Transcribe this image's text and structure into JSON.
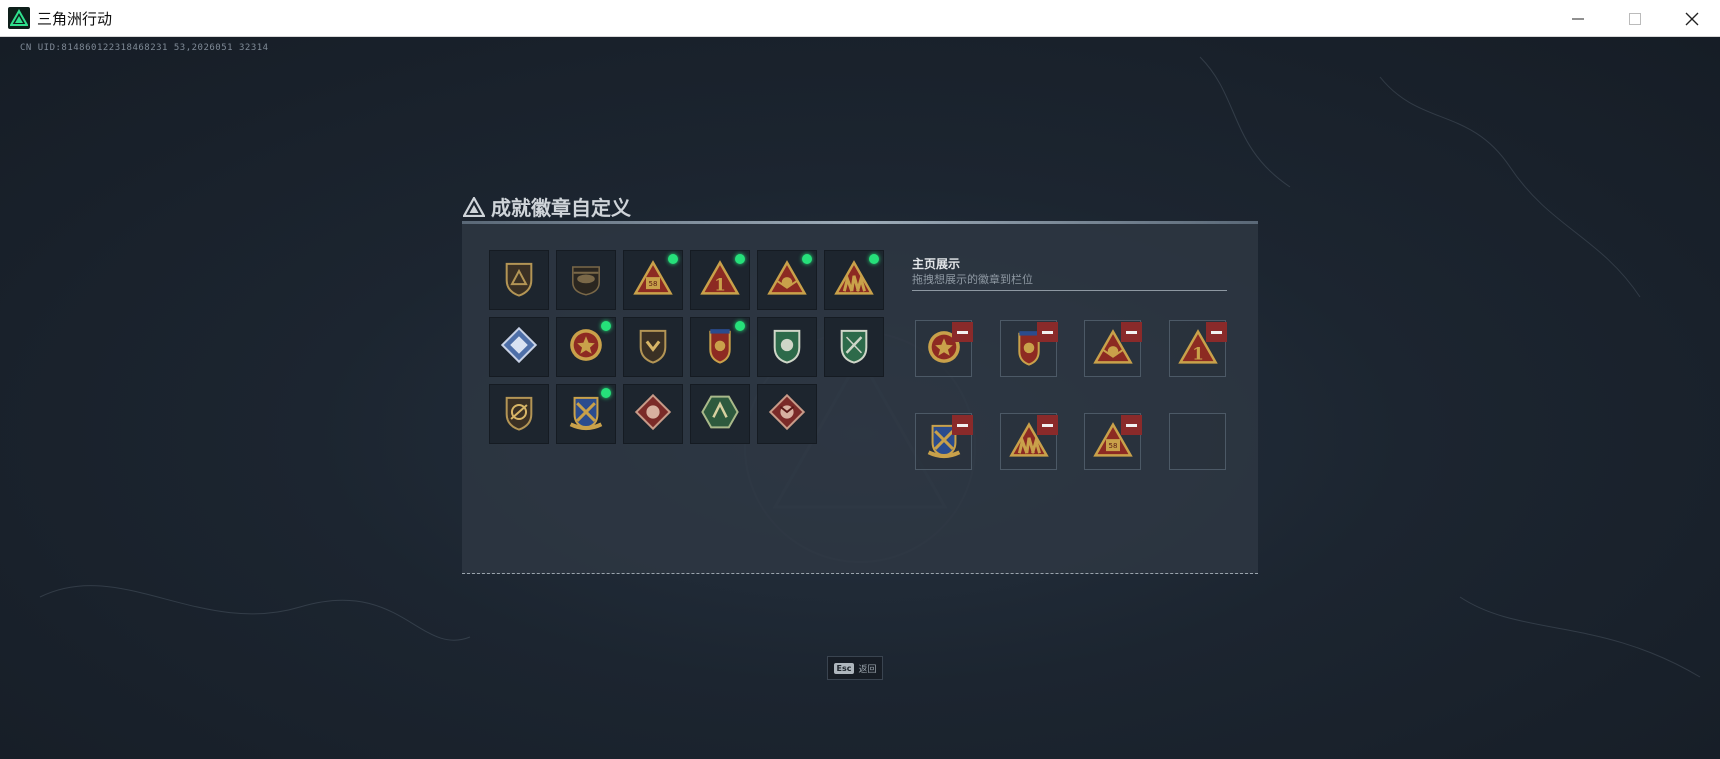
{
  "window": {
    "title": "三角洲行动",
    "controls": [
      "minimize",
      "maximize",
      "close"
    ]
  },
  "uid_text": "CN UID:814860122318468231 53,2026051 32314",
  "panel": {
    "title": "成就徽章自定义",
    "badges": [
      {
        "icon": "delta-shield-badge",
        "new": false
      },
      {
        "icon": "helicopter-badge",
        "new": false
      },
      {
        "icon": "triangle-58-badge",
        "new": true
      },
      {
        "icon": "triangle-1-badge",
        "new": true
      },
      {
        "icon": "triangle-winged-badge",
        "new": true
      },
      {
        "icon": "triangle-soldiers-badge",
        "new": true
      },
      {
        "icon": "blue-diamond-badge",
        "new": false
      },
      {
        "icon": "red-star-medal-badge",
        "new": true
      },
      {
        "icon": "shield-chevron-badge",
        "new": false
      },
      {
        "icon": "ribbon-shield-badge",
        "new": true
      },
      {
        "icon": "green-lion-shield-badge",
        "new": false
      },
      {
        "icon": "green-crossed-shield-badge",
        "new": false
      },
      {
        "icon": "slash-shield-badge",
        "new": false
      },
      {
        "icon": "crossed-swords-crest-badge",
        "new": true
      },
      {
        "icon": "beast-diamond-badge",
        "new": false
      },
      {
        "icon": "green-hex-badge",
        "new": false
      },
      {
        "icon": "dragon-diamond-badge",
        "new": false
      }
    ],
    "showcase": {
      "title": "主页展示",
      "subtitle": "拖拽想展示的徽章到栏位",
      "slots": [
        {
          "icon": "red-star-medal-badge",
          "filled": true
        },
        {
          "icon": "ribbon-shield-badge",
          "filled": true
        },
        {
          "icon": "triangle-winged-badge",
          "filled": true
        },
        {
          "icon": "triangle-1-badge",
          "filled": true
        },
        {
          "icon": "crossed-swords-crest-badge",
          "filled": true
        },
        {
          "icon": "triangle-soldiers-badge",
          "filled": true
        },
        {
          "icon": "triangle-58-badge",
          "filled": true
        },
        {
          "icon": "",
          "filled": false
        }
      ]
    }
  },
  "footer": {
    "esc_key": "Esc",
    "esc_label": "返回"
  },
  "colors": {
    "accent_green": "#26e07a",
    "remove_red": "#8a2a2a",
    "badge_gold": "#c9a14a",
    "panel_bg": "#303944"
  }
}
